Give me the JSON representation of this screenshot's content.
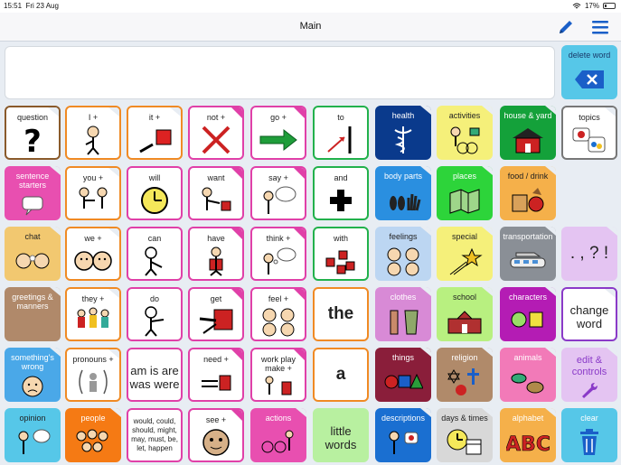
{
  "status": {
    "time": "15:51",
    "date": "Fri 23 Aug",
    "battery": "17%"
  },
  "header": {
    "title": "Main",
    "edit_icon": "pencil-icon",
    "menu_icon": "hamburger-menu-icon"
  },
  "message_bar": {
    "text": ""
  },
  "colors": {
    "pronoun": "#f08a24",
    "verb": "#e040a8",
    "preposition": "#22b14c",
    "folder_blue": "#1a6fd1"
  },
  "cells": [
    {
      "label": "question",
      "icon": "question-mark-icon"
    },
    {
      "label": "I +",
      "icon": "person-self-icon"
    },
    {
      "label": "it +",
      "icon": "point-to-object-icon"
    },
    {
      "label": "not +",
      "icon": "red-cross-icon"
    },
    {
      "label": "go +",
      "icon": "green-arrow-icon"
    },
    {
      "label": "to",
      "icon": "arrow-to-line-icon"
    },
    {
      "label": "health",
      "icon": "caduceus-icon"
    },
    {
      "label": "activities",
      "icon": "activities-icon"
    },
    {
      "label": "house & yard",
      "icon": "house-icon"
    },
    {
      "label": "topics",
      "icon": "topics-bubbles-icon"
    },
    {
      "label": "delete word",
      "icon": "backspace-icon"
    },
    {
      "label": "sentence starters",
      "icon": "speech-bubble-icon"
    },
    {
      "label": "you +",
      "icon": "people-pointing-icon"
    },
    {
      "label": "will",
      "icon": "clock-icon"
    },
    {
      "label": "want",
      "icon": "reach-for-icon"
    },
    {
      "label": "say +",
      "icon": "speak-icon"
    },
    {
      "label": "and",
      "icon": "plus-icon"
    },
    {
      "label": "body parts",
      "icon": "feet-hand-icon"
    },
    {
      "label": "places",
      "icon": "map-icon"
    },
    {
      "label": "food / drink",
      "icon": "food-icon"
    },
    {
      "label": "chat",
      "icon": "chat-faces-icon"
    },
    {
      "label": "we +",
      "icon": "two-faces-icon"
    },
    {
      "label": "can",
      "icon": "person-can-icon"
    },
    {
      "label": "have",
      "icon": "person-holding-icon"
    },
    {
      "label": "think +",
      "icon": "think-bubble-icon"
    },
    {
      "label": "with",
      "icon": "with-group-icon"
    },
    {
      "label": "feelings",
      "icon": "feeling-faces-icon"
    },
    {
      "label": "special",
      "icon": "shooting-star-icon"
    },
    {
      "label": "transportation",
      "icon": "train-icon"
    },
    {
      "label": ". , ? !",
      "icon": ""
    },
    {
      "label": "greetings & manners",
      "icon": ""
    },
    {
      "label": "they +",
      "icon": "group-people-icon"
    },
    {
      "label": "do",
      "icon": "person-do-icon"
    },
    {
      "label": "get",
      "icon": "get-object-icon"
    },
    {
      "label": "feel +",
      "icon": "feel-faces-icon"
    },
    {
      "label": "the",
      "icon": ""
    },
    {
      "label": "clothes",
      "icon": "clothes-icon"
    },
    {
      "label": "school",
      "icon": "school-building-icon"
    },
    {
      "label": "characters",
      "icon": "characters-icon"
    },
    {
      "label": "change word",
      "icon": ""
    },
    {
      "label": "something's wrong",
      "icon": "worried-face-icon"
    },
    {
      "label": "pronouns +",
      "icon": "pronoun-person-icon"
    },
    {
      "label": "am is are was were",
      "icon": ""
    },
    {
      "label": "need +",
      "icon": "reach-need-icon"
    },
    {
      "label": "work play make +",
      "icon": "work-play-icon"
    },
    {
      "label": "a",
      "icon": ""
    },
    {
      "label": "things",
      "icon": "shapes-icon"
    },
    {
      "label": "religion",
      "icon": "religion-symbols-icon"
    },
    {
      "label": "animals",
      "icon": "animals-icon"
    },
    {
      "label": "edit & controls",
      "icon": "wrench-icon"
    },
    {
      "label": "opinion",
      "icon": "opinion-icon"
    },
    {
      "label": "people",
      "icon": "people-crowd-icon"
    },
    {
      "label": "would, could, should, might, may, must, be, let, happen",
      "icon": ""
    },
    {
      "label": "see +",
      "icon": "see-face-icon"
    },
    {
      "label": "actions",
      "icon": "actions-icon"
    },
    {
      "label": "little words",
      "icon": ""
    },
    {
      "label": "descriptions",
      "icon": "descriptions-icon"
    },
    {
      "label": "days & times",
      "icon": "calendar-clock-icon"
    },
    {
      "label": "alphabet",
      "icon": "abc-icon"
    },
    {
      "label": "clear",
      "icon": "trash-icon"
    }
  ]
}
